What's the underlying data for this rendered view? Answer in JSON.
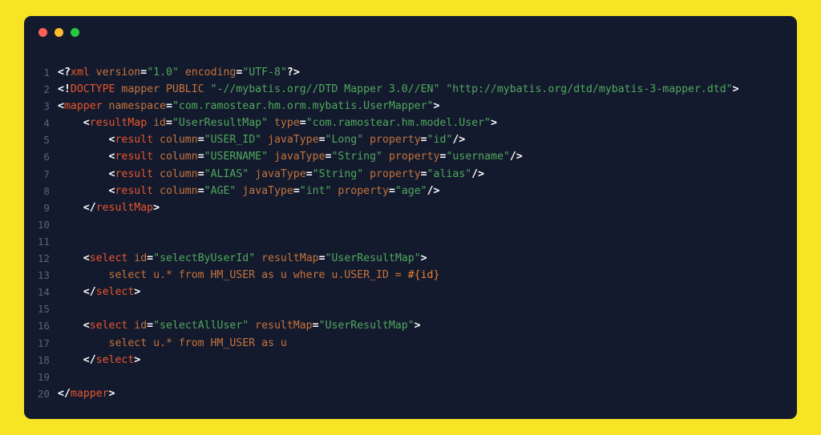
{
  "window": {
    "traffic_lights": [
      {
        "name": "close",
        "color": "#FF5F56"
      },
      {
        "name": "minimize",
        "color": "#FFBD2E"
      },
      {
        "name": "maximize",
        "color": "#27C93F"
      }
    ],
    "background_color": "#141A2E",
    "page_background_color": "#F7E425"
  },
  "editor": {
    "language": "xml",
    "colors": {
      "punctuation": "#FFFFFF",
      "tag": "#E8552D",
      "attribute": "#C5733A",
      "string": "#4FA85C",
      "text": "#C5733A",
      "parameter": "#E8822D",
      "line_number": "#5A6378"
    },
    "lines": [
      {
        "number": "1",
        "tokens": [
          {
            "t": "pun",
            "v": "<?"
          },
          {
            "t": "tag",
            "v": "xml"
          },
          {
            "t": "att",
            "v": " version"
          },
          {
            "t": "pun",
            "v": "="
          },
          {
            "t": "str",
            "v": "\"1.0\""
          },
          {
            "t": "att",
            "v": " encoding"
          },
          {
            "t": "pun",
            "v": "="
          },
          {
            "t": "str",
            "v": "\"UTF-8\""
          },
          {
            "t": "pun",
            "v": "?>"
          }
        ]
      },
      {
        "number": "2",
        "tokens": [
          {
            "t": "pun",
            "v": "<!"
          },
          {
            "t": "tag",
            "v": "DOCTYPE"
          },
          {
            "t": "att",
            "v": " mapper PUBLIC "
          },
          {
            "t": "str",
            "v": "\"-//mybatis.org//DTD Mapper 3.0//EN\""
          },
          {
            "t": "att",
            "v": " "
          },
          {
            "t": "str",
            "v": "\"http://mybatis.org/dtd/mybatis-3-mapper.dtd\""
          },
          {
            "t": "pun",
            "v": ">"
          }
        ]
      },
      {
        "number": "3",
        "tokens": [
          {
            "t": "pun",
            "v": "<"
          },
          {
            "t": "tag",
            "v": "mapper"
          },
          {
            "t": "att",
            "v": " namespace"
          },
          {
            "t": "pun",
            "v": "="
          },
          {
            "t": "str",
            "v": "\"com.ramostear.hm.orm.mybatis.UserMapper\""
          },
          {
            "t": "pun",
            "v": ">"
          }
        ]
      },
      {
        "number": "4",
        "tokens": [
          {
            "t": "pun",
            "v": "    <"
          },
          {
            "t": "tag",
            "v": "resultMap"
          },
          {
            "t": "att",
            "v": " id"
          },
          {
            "t": "pun",
            "v": "="
          },
          {
            "t": "str",
            "v": "\"UserResultMap\""
          },
          {
            "t": "att",
            "v": " type"
          },
          {
            "t": "pun",
            "v": "="
          },
          {
            "t": "str",
            "v": "\"com.ramostear.hm.model.User\""
          },
          {
            "t": "pun",
            "v": ">"
          }
        ]
      },
      {
        "number": "5",
        "tokens": [
          {
            "t": "pun",
            "v": "        <"
          },
          {
            "t": "tag",
            "v": "result"
          },
          {
            "t": "att",
            "v": " column"
          },
          {
            "t": "pun",
            "v": "="
          },
          {
            "t": "str",
            "v": "\"USER_ID\""
          },
          {
            "t": "att",
            "v": " javaType"
          },
          {
            "t": "pun",
            "v": "="
          },
          {
            "t": "str",
            "v": "\"Long\""
          },
          {
            "t": "att",
            "v": " property"
          },
          {
            "t": "pun",
            "v": "="
          },
          {
            "t": "str",
            "v": "\"id\""
          },
          {
            "t": "pun",
            "v": "/>"
          }
        ]
      },
      {
        "number": "6",
        "tokens": [
          {
            "t": "pun",
            "v": "        <"
          },
          {
            "t": "tag",
            "v": "result"
          },
          {
            "t": "att",
            "v": " column"
          },
          {
            "t": "pun",
            "v": "="
          },
          {
            "t": "str",
            "v": "\"USERNAME\""
          },
          {
            "t": "att",
            "v": " javaType"
          },
          {
            "t": "pun",
            "v": "="
          },
          {
            "t": "str",
            "v": "\"String\""
          },
          {
            "t": "att",
            "v": " property"
          },
          {
            "t": "pun",
            "v": "="
          },
          {
            "t": "str",
            "v": "\"username\""
          },
          {
            "t": "pun",
            "v": "/>"
          }
        ]
      },
      {
        "number": "7",
        "tokens": [
          {
            "t": "pun",
            "v": "        <"
          },
          {
            "t": "tag",
            "v": "result"
          },
          {
            "t": "att",
            "v": " column"
          },
          {
            "t": "pun",
            "v": "="
          },
          {
            "t": "str",
            "v": "\"ALIAS\""
          },
          {
            "t": "att",
            "v": " javaType"
          },
          {
            "t": "pun",
            "v": "="
          },
          {
            "t": "str",
            "v": "\"String\""
          },
          {
            "t": "att",
            "v": " property"
          },
          {
            "t": "pun",
            "v": "="
          },
          {
            "t": "str",
            "v": "\"alias\""
          },
          {
            "t": "pun",
            "v": "/>"
          }
        ]
      },
      {
        "number": "8",
        "tokens": [
          {
            "t": "pun",
            "v": "        <"
          },
          {
            "t": "tag",
            "v": "result"
          },
          {
            "t": "att",
            "v": " column"
          },
          {
            "t": "pun",
            "v": "="
          },
          {
            "t": "str",
            "v": "\"AGE\""
          },
          {
            "t": "att",
            "v": " javaType"
          },
          {
            "t": "pun",
            "v": "="
          },
          {
            "t": "str",
            "v": "\"int\""
          },
          {
            "t": "att",
            "v": " property"
          },
          {
            "t": "pun",
            "v": "="
          },
          {
            "t": "str",
            "v": "\"age\""
          },
          {
            "t": "pun",
            "v": "/>"
          }
        ]
      },
      {
        "number": "9",
        "tokens": [
          {
            "t": "pun",
            "v": "    </"
          },
          {
            "t": "tag",
            "v": "resultMap"
          },
          {
            "t": "pun",
            "v": ">"
          }
        ]
      },
      {
        "number": "10",
        "tokens": []
      },
      {
        "number": "11",
        "tokens": []
      },
      {
        "number": "12",
        "tokens": [
          {
            "t": "pun",
            "v": "    <"
          },
          {
            "t": "tag",
            "v": "select"
          },
          {
            "t": "att",
            "v": " id"
          },
          {
            "t": "pun",
            "v": "="
          },
          {
            "t": "str",
            "v": "\"selectByUserId\""
          },
          {
            "t": "att",
            "v": " resultMap"
          },
          {
            "t": "pun",
            "v": "="
          },
          {
            "t": "str",
            "v": "\"UserResultMap\""
          },
          {
            "t": "pun",
            "v": ">"
          }
        ]
      },
      {
        "number": "13",
        "tokens": [
          {
            "t": "txt",
            "v": "        select u.* from HM_USER as u where u.USER_ID = "
          },
          {
            "t": "par",
            "v": "#{id}"
          }
        ]
      },
      {
        "number": "14",
        "tokens": [
          {
            "t": "pun",
            "v": "    </"
          },
          {
            "t": "tag",
            "v": "select"
          },
          {
            "t": "pun",
            "v": ">"
          }
        ]
      },
      {
        "number": "15",
        "tokens": []
      },
      {
        "number": "16",
        "tokens": [
          {
            "t": "pun",
            "v": "    <"
          },
          {
            "t": "tag",
            "v": "select"
          },
          {
            "t": "att",
            "v": " id"
          },
          {
            "t": "pun",
            "v": "="
          },
          {
            "t": "str",
            "v": "\"selectAllUser\""
          },
          {
            "t": "att",
            "v": " resultMap"
          },
          {
            "t": "pun",
            "v": "="
          },
          {
            "t": "str",
            "v": "\"UserResultMap\""
          },
          {
            "t": "pun",
            "v": ">"
          }
        ]
      },
      {
        "number": "17",
        "tokens": [
          {
            "t": "txt",
            "v": "        select u.* from HM_USER as u"
          }
        ]
      },
      {
        "number": "18",
        "tokens": [
          {
            "t": "pun",
            "v": "    </"
          },
          {
            "t": "tag",
            "v": "select"
          },
          {
            "t": "pun",
            "v": ">"
          }
        ]
      },
      {
        "number": "19",
        "tokens": []
      },
      {
        "number": "20",
        "tokens": [
          {
            "t": "pun",
            "v": "</"
          },
          {
            "t": "tag",
            "v": "mapper"
          },
          {
            "t": "pun",
            "v": ">"
          }
        ]
      }
    ]
  }
}
